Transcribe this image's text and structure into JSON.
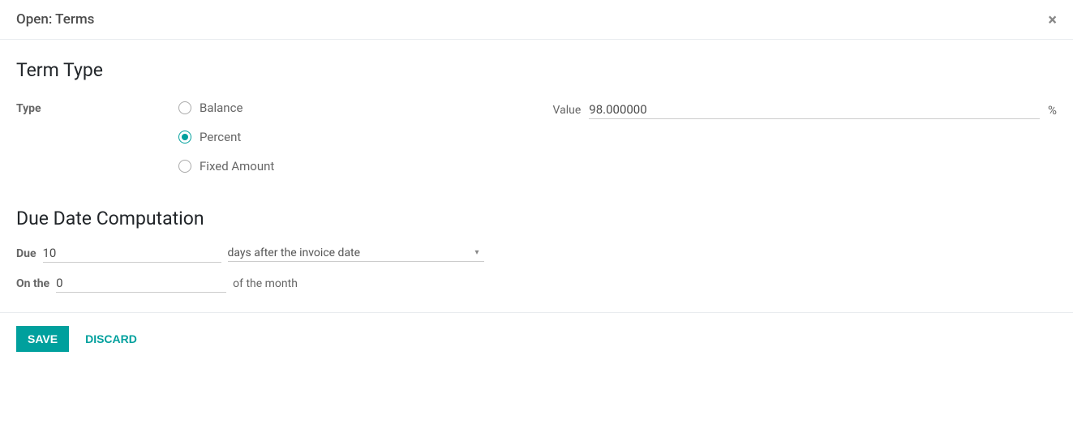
{
  "header": {
    "title": "Open: Terms"
  },
  "sections": {
    "term_type_heading": "Term Type",
    "due_date_heading": "Due Date Computation"
  },
  "type_field": {
    "label": "Type",
    "options": {
      "balance": "Balance",
      "percent": "Percent",
      "fixed": "Fixed Amount"
    },
    "selected": "percent"
  },
  "value_field": {
    "label": "Value",
    "value": "98.000000",
    "unit": "%"
  },
  "due_field": {
    "label": "Due",
    "value": "10",
    "basis_selected": "days after the invoice date"
  },
  "on_the_field": {
    "label": "On the",
    "value": "0",
    "suffix": "of the month"
  },
  "footer": {
    "save": "Save",
    "discard": "Discard"
  }
}
